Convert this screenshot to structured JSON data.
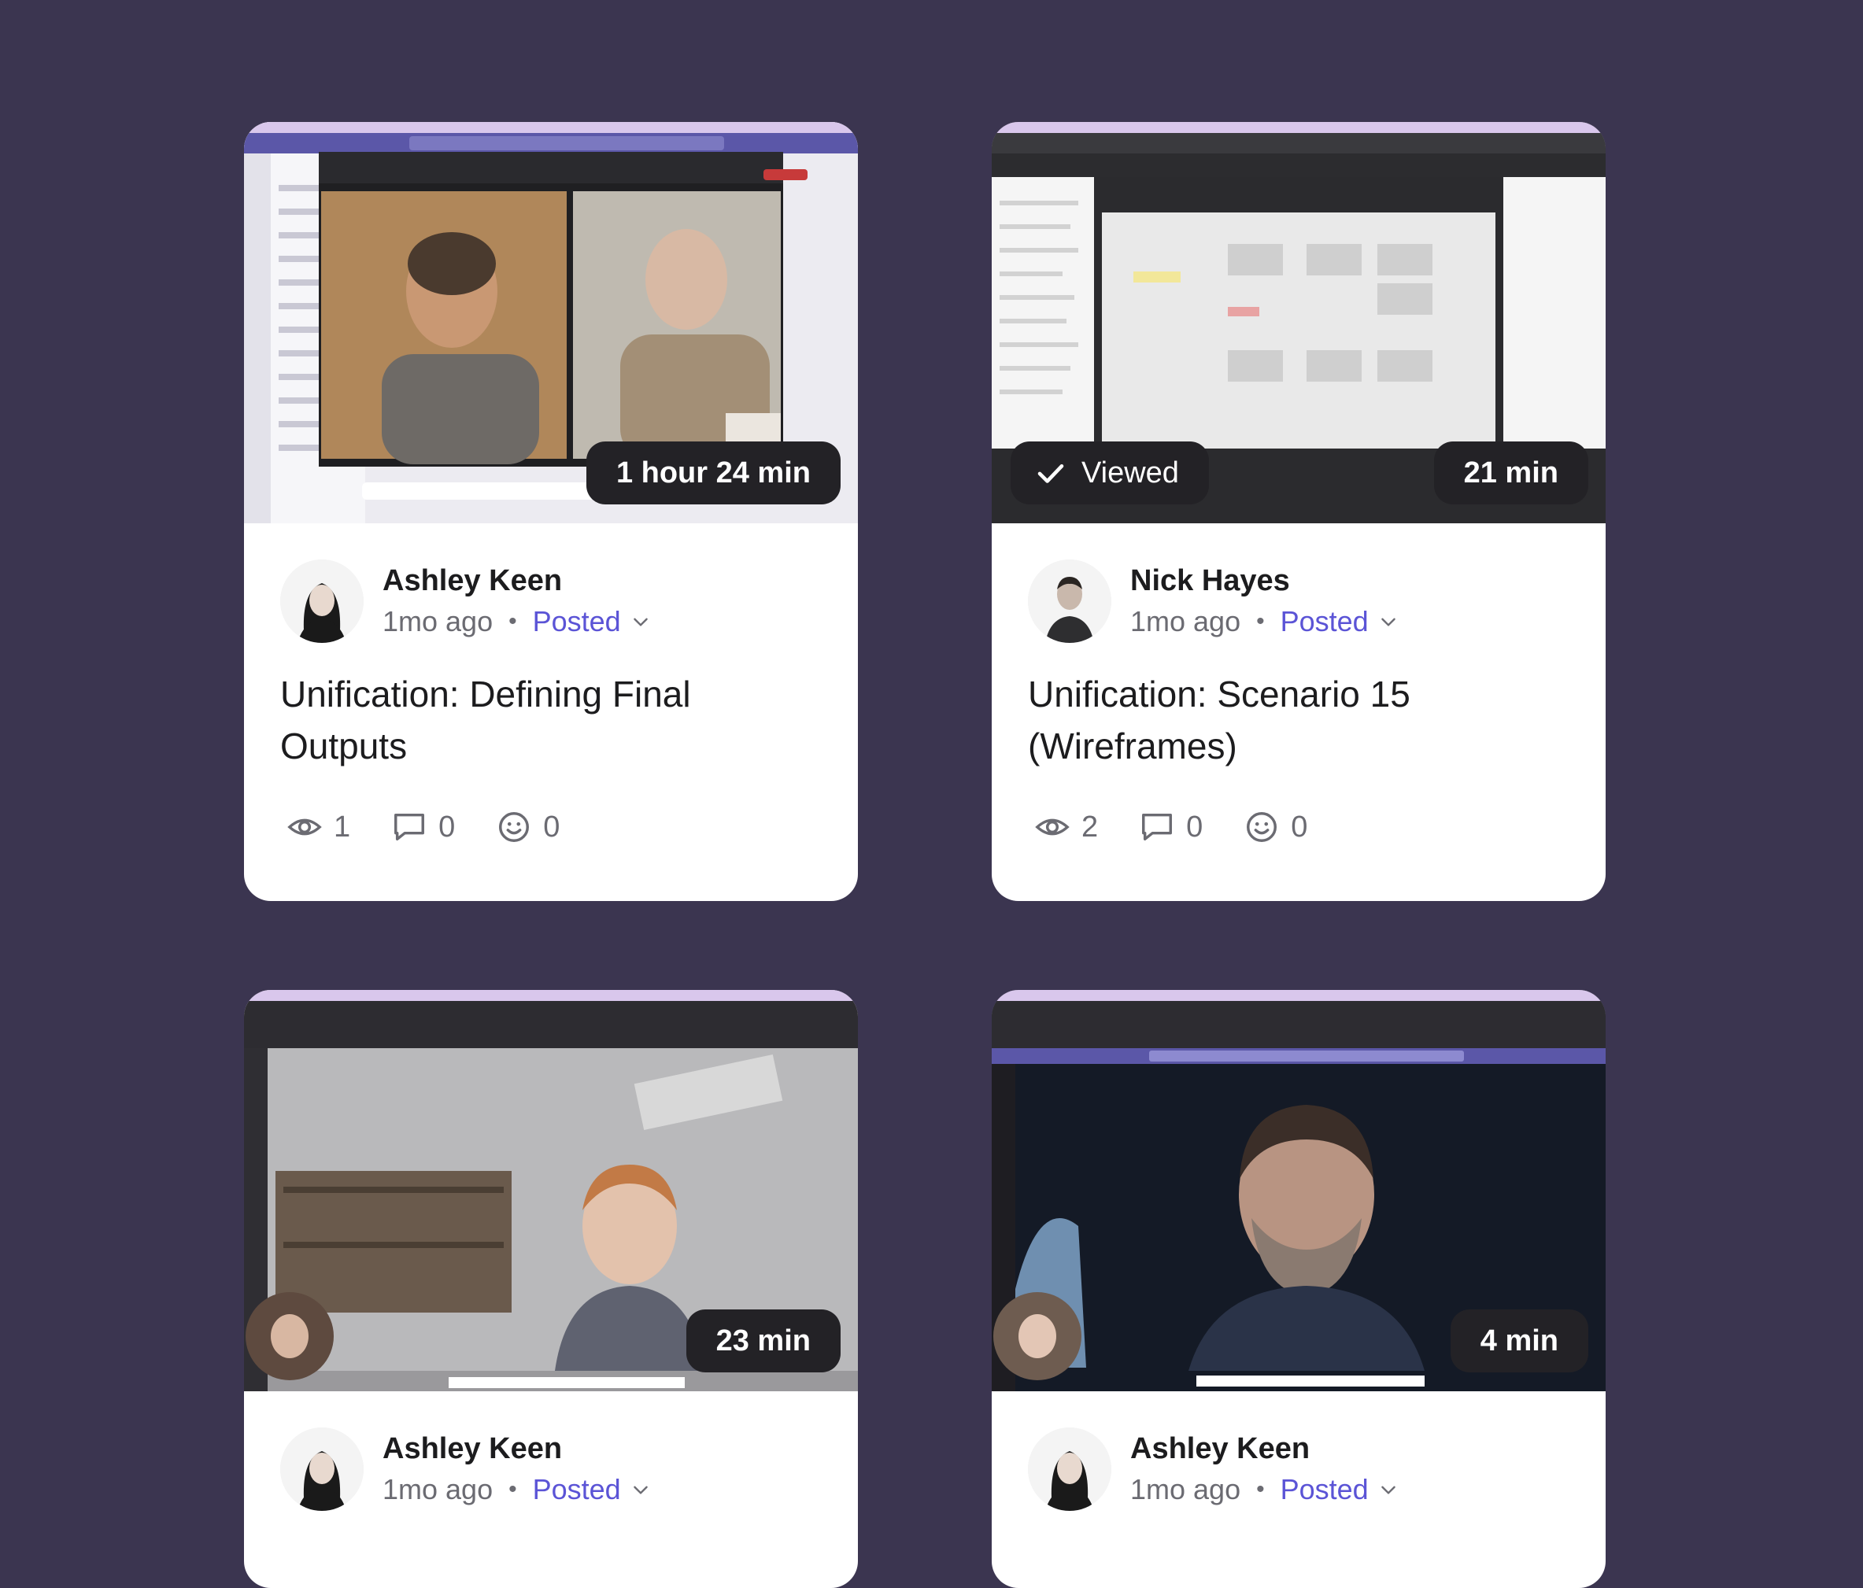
{
  "cards": [
    {
      "duration": "1 hour 24 min",
      "author": "Ashley Keen",
      "age": "1mo ago",
      "status": "Posted",
      "title": "Unification: Defining Final Outputs",
      "views": "1",
      "comments": "0",
      "reactions": "0"
    },
    {
      "viewed_label": "Viewed",
      "duration": "21 min",
      "author": "Nick Hayes",
      "age": "1mo ago",
      "status": "Posted",
      "title": "Unification: Scenario 15 (Wireframes)",
      "views": "2",
      "comments": "0",
      "reactions": "0"
    },
    {
      "duration": "23 min",
      "author": "Ashley Keen",
      "age": "1mo ago",
      "status": "Posted"
    },
    {
      "duration": "4 min",
      "author": "Ashley Keen",
      "age": "1mo ago",
      "status": "Posted"
    }
  ],
  "icons": {
    "views": "eye-icon",
    "comments": "comment-icon",
    "reactions": "smiley-icon",
    "status_menu": "chevron-down-icon",
    "viewed": "check-icon"
  },
  "colors": {
    "background": "#3b3550",
    "card": "#ffffff",
    "accent": "#5b54d6",
    "badge": "#232226"
  }
}
